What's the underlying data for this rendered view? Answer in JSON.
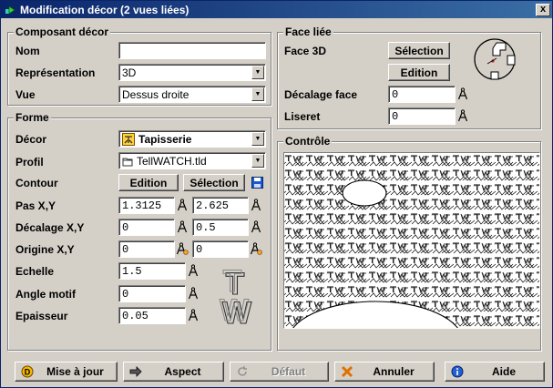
{
  "window": {
    "title": "Modification décor (2 vues liées)",
    "close_label": "x"
  },
  "composant": {
    "title": "Composant décor",
    "nom_label": "Nom",
    "nom_value": "",
    "representation_label": "Représentation",
    "representation_value": "3D",
    "vue_label": "Vue",
    "vue_value": "Dessus droite"
  },
  "forme": {
    "title": "Forme",
    "decor_label": "Décor",
    "decor_value": "Tapisserie",
    "profil_label": "Profil",
    "profil_value": "TellWATCH.tld",
    "contour_label": "Contour",
    "contour_edition": "Edition",
    "contour_selection": "Sélection",
    "pas_label": "Pas X,Y",
    "pas_x": "1.3125",
    "pas_y": "2.625",
    "decalage_label": "Décalage X,Y",
    "decalage_x": "0",
    "decalage_y": "0.5",
    "origine_label": "Origine X,Y",
    "origine_x": "0",
    "origine_y": "0",
    "echelle_label": "Echelle",
    "echelle_value": "1.5",
    "angle_label": "Angle motif",
    "angle_value": "0",
    "epaisseur_label": "Epaisseur",
    "epaisseur_value": "0.05",
    "logo_letters": [
      "T",
      "W"
    ]
  },
  "face": {
    "title": "Face liée",
    "face3d_label": "Face 3D",
    "selection_label": "Sélection",
    "edition_label": "Edition",
    "decalage_label": "Décalage face",
    "decalage_value": "0",
    "liseret_label": "Liseret",
    "liseret_value": "0"
  },
  "controle": {
    "title": "Contrôle"
  },
  "buttons": {
    "maj": "Mise à jour",
    "aspect": "Aspect",
    "defaut": "Défaut",
    "annuler": "Annuler",
    "aide": "Aide"
  },
  "colors": {
    "title_start": "#0a246a",
    "title_end": "#3a6ea5",
    "face": "#d4d0c8"
  }
}
